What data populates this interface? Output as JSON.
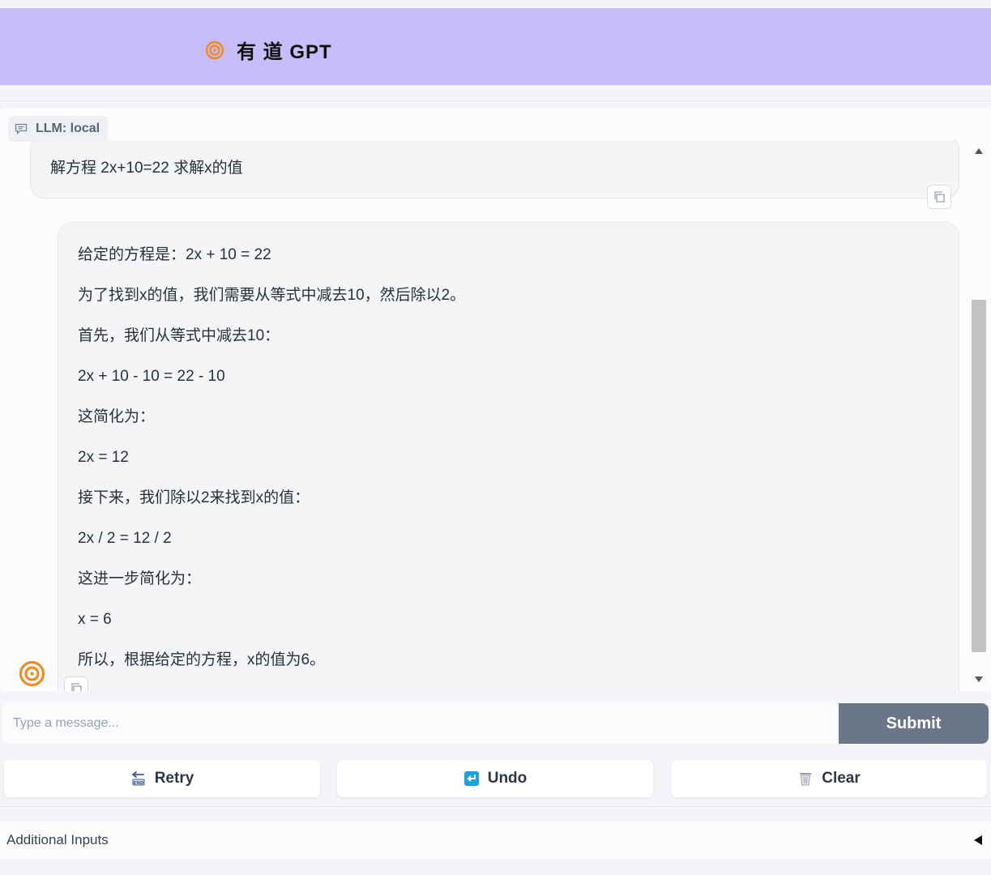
{
  "header": {
    "title": "有 道 GPT",
    "logo_icon": "spiral-logo-icon"
  },
  "chatbot": {
    "label": "LLM: local"
  },
  "messages": {
    "user": "解方程 2x+10=22 求解x的值",
    "bot": [
      "给定的方程是：2x + 10 = 22",
      "为了找到x的值，我们需要从等式中减去10，然后除以2。",
      "首先，我们从等式中减去10：",
      "2x + 10 - 10 = 22 - 10",
      "这简化为：",
      "2x = 12",
      "接下来，我们除以2来找到x的值：",
      "2x / 2 = 12 / 2",
      "这进一步简化为：",
      "x = 6",
      "所以，根据给定的方程，x的值为6。"
    ]
  },
  "composer": {
    "placeholder": "Type a message...",
    "submit_label": "Submit"
  },
  "actions": {
    "retry_label": "Retry",
    "undo_label": "Undo",
    "clear_label": "Clear"
  },
  "additional": {
    "label": "Additional Inputs"
  },
  "colors": {
    "header_bg": "#c8bcfb",
    "submit_bg": "#6b7688",
    "logo_orange": "#f08a24"
  }
}
